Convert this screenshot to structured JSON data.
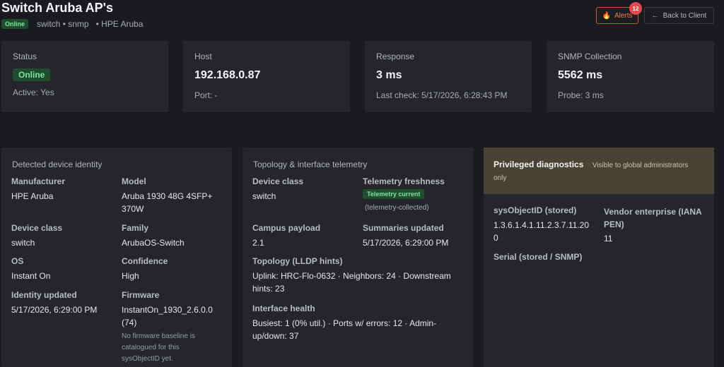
{
  "header": {
    "title": "Switch Aruba AP's",
    "status_pill": "Online",
    "meta_class": "switch • snmp",
    "meta_vendor": "• HPE Aruba",
    "alerts_label": "Alerts",
    "alerts_count": "12",
    "back_label": "Back to Client"
  },
  "stats": {
    "status": {
      "label": "Status",
      "pill": "Online",
      "sub": "Active: Yes"
    },
    "host": {
      "label": "Host",
      "value": "192.168.0.87",
      "sub": "Port: -"
    },
    "response": {
      "label": "Response",
      "value": "3 ms",
      "sub": "Last check: 5/17/2026, 6:28:43 PM"
    },
    "snmp": {
      "label": "SNMP Collection",
      "value": "5562 ms",
      "sub": "Probe: 3 ms"
    }
  },
  "identity": {
    "heading": "Detected device identity",
    "manufacturer_label": "Manufacturer",
    "manufacturer": "HPE Aruba",
    "model_label": "Model",
    "model_line1": "Aruba 1930 48G 4SFP+",
    "model_line2": "370W",
    "device_class_label": "Device class",
    "device_class": "switch",
    "family_label": "Family",
    "family": "ArubaOS-Switch",
    "os_label": "OS",
    "os": "Instant On",
    "confidence_label": "Confidence",
    "confidence": "High",
    "identity_updated_label": "Identity updated",
    "identity_updated": "5/17/2026, 6:29:00 PM",
    "firmware_label": "Firmware",
    "firmware_line1": "InstantOn_1930_2.6.0.0",
    "firmware_line2": "(74)",
    "firmware_note_1": "No firmware baseline is",
    "firmware_note_2": "catalogued for this",
    "firmware_note_3": "sysObjectID yet."
  },
  "topology": {
    "heading": "Topology & interface telemetry",
    "device_class_label": "Device class",
    "device_class": "switch",
    "freshness_label": "Telemetry freshness",
    "freshness_pill": "Telemetry current",
    "freshness_note": "(telemetry-collected)",
    "campus_label": "Campus payload",
    "campus": "2.1",
    "summaries_label": "Summaries updated",
    "summaries": "5/17/2026, 6:29:00 PM",
    "lldp_label": "Topology (LLDP hints)",
    "lldp_line1": "Uplink: HRC-Flo-0632 · Neighbors: 24 · Downstream",
    "lldp_line2": "hints: 23",
    "health_label": "Interface health",
    "health_line1": "Busiest: 1 (0% util.) · Ports w/ errors: 12 · Admin-",
    "health_line2": "up/down: 37"
  },
  "privileged": {
    "title": "Privileged diagnostics",
    "subtitle_1": "Visible to global administrators",
    "subtitle_2": "only",
    "sysobjectid_label": "sysObjectID (stored)",
    "sysobjectid_line1": "1.3.6.1.4.1.11.2.3.7.11.20",
    "sysobjectid_line2": "0",
    "vendor_label_1": "Vendor enterprise (IANA",
    "vendor_label_2": "PEN)",
    "vendor_value": "11",
    "serial_label": "Serial (stored / SNMP)"
  }
}
